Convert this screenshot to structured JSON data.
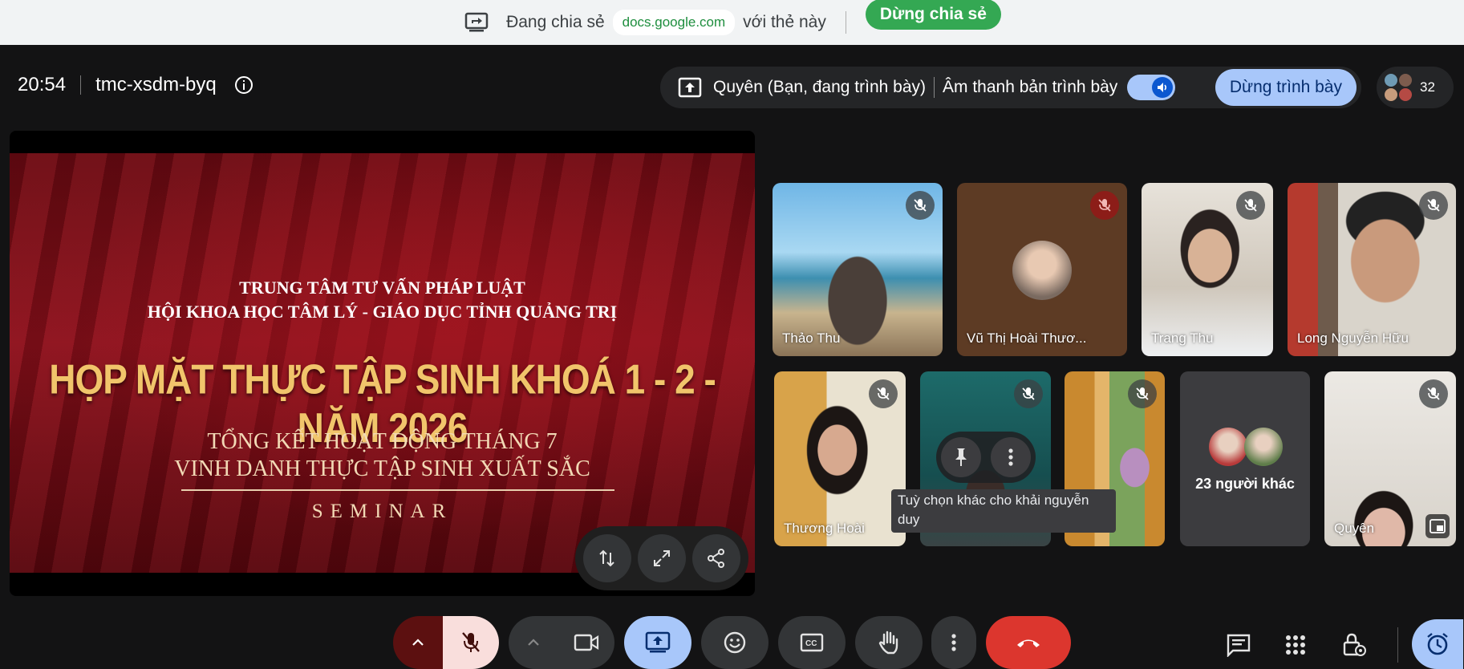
{
  "share_bar": {
    "sharing_label": "Đang chia sẻ",
    "domain": "docs.google.com",
    "tab_label": "với thẻ này",
    "stop_sharing": "Dừng chia sẻ"
  },
  "meeting": {
    "time": "20:54",
    "code": "tmc-xsdm-byq"
  },
  "presenting": {
    "presenter_label": "Quyên (Bạn, đang trình bày)",
    "audio_label": "Âm thanh bản trình bày",
    "audio_on": true,
    "stop_presenting": "Dừng trình bày"
  },
  "participants_count": "32",
  "slide": {
    "line1": "TRUNG TÂM TƯ VẤN PHÁP LUẬT",
    "line2": "HỘI KHOA HỌC TÂM LÝ - GIÁO DỤC TỈNH QUẢNG TRỊ",
    "headline": "HỌP MẶT THỰC TẬP SINH KHOÁ 1 - 2 - NĂM 2026",
    "line4": "TỔNG KẾT HOẠT ĐỘNG THÁNG 7",
    "line5": "VINH DANH THỰC TẬP SINH XUẤT SẮC",
    "line6": "SEMINAR"
  },
  "tiles": {
    "thao": "Thảo Thu",
    "vu": "Vũ Thị Hoài Thươ...",
    "trang": "Trang Thu",
    "long": "Long Nguyễn Hữu",
    "thuong": "Thương Hoài",
    "others": "23 người khác",
    "quyen": "Quyên"
  },
  "tooltip": "Tuỳ chọn khác cho khải nguyễn duy",
  "colors": {
    "accent_blue": "#a8c7fa",
    "leave_red": "#dc362e",
    "share_green": "#34a853",
    "background": "#131314"
  }
}
